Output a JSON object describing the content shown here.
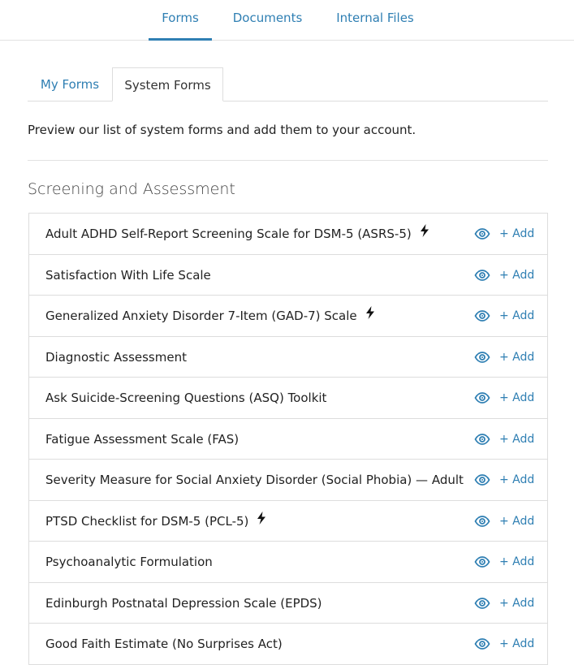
{
  "topnav": {
    "tabs": [
      {
        "label": "Forms",
        "active": true
      },
      {
        "label": "Documents",
        "active": false
      },
      {
        "label": "Internal Files",
        "active": false
      }
    ]
  },
  "subtabs": {
    "my_forms": "My Forms",
    "system_forms": "System Forms"
  },
  "intro_text": "Preview our list of system forms and add them to your account.",
  "section_title": "Screening and Assessment",
  "add_label": "+ Add",
  "forms": [
    {
      "name": "Adult ADHD Self-Report Screening Scale for DSM-5 (ASRS-5)",
      "bolt": true
    },
    {
      "name": "Satisfaction With Life Scale",
      "bolt": false
    },
    {
      "name": "Generalized Anxiety Disorder 7-Item (GAD-7) Scale",
      "bolt": true
    },
    {
      "name": "Diagnostic Assessment",
      "bolt": false
    },
    {
      "name": "Ask Suicide-Screening Questions (ASQ) Toolkit",
      "bolt": false
    },
    {
      "name": "Fatigue Assessment Scale (FAS)",
      "bolt": false
    },
    {
      "name": "Severity Measure for Social Anxiety Disorder (Social Phobia) — Adult",
      "bolt": false
    },
    {
      "name": "PTSD Checklist for DSM-5 (PCL-5)",
      "bolt": true
    },
    {
      "name": "Psychoanalytic Formulation",
      "bolt": false
    },
    {
      "name": "Edinburgh Postnatal Depression Scale (EPDS)",
      "bolt": false
    },
    {
      "name": "Good Faith Estimate (No Surprises Act)",
      "bolt": false
    }
  ],
  "colors": {
    "accent": "#2f7fb3",
    "border": "#dddddd",
    "text": "#222222"
  }
}
